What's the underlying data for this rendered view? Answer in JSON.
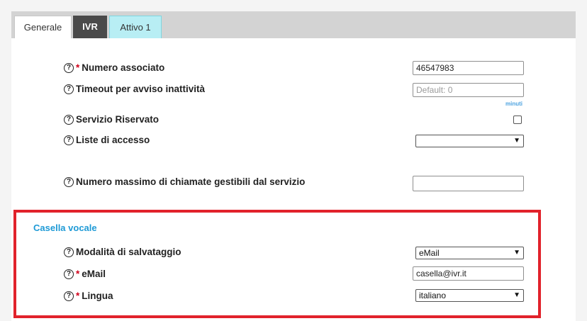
{
  "tabs": [
    {
      "label": "Generale"
    },
    {
      "label": "IVR"
    },
    {
      "label": "Attivo 1"
    }
  ],
  "fields": {
    "numero_associato": {
      "label": "Numero associato",
      "value": "46547983",
      "required": true
    },
    "timeout": {
      "label": "Timeout per avviso inattività",
      "placeholder": "Default: 0",
      "unit": "minuti"
    },
    "servizio_riservato": {
      "label": "Servizio Riservato",
      "checked": false
    },
    "liste_accesso": {
      "label": "Liste di accesso",
      "value": ""
    },
    "numero_massimo": {
      "label": "Numero massimo di chiamate gestibili dal servizio",
      "value": ""
    }
  },
  "casella_vocale": {
    "title": "Casella vocale",
    "modalita": {
      "label": "Modalità di salvataggio",
      "value": "eMail"
    },
    "email": {
      "label": "eMail",
      "value": "casella@ivr.it",
      "required": true
    },
    "lingua": {
      "label": "Lingua",
      "value": "italiano",
      "required": true
    }
  },
  "icons": {
    "help": "question-circle-icon",
    "dropdown": "chevron-down-icon"
  },
  "colors": {
    "highlight_border": "#e1222b",
    "section_title": "#1e9ad6",
    "required": "#d0021b",
    "tab_active": "#b8eef4",
    "tab_dark": "#4a4a4a"
  }
}
